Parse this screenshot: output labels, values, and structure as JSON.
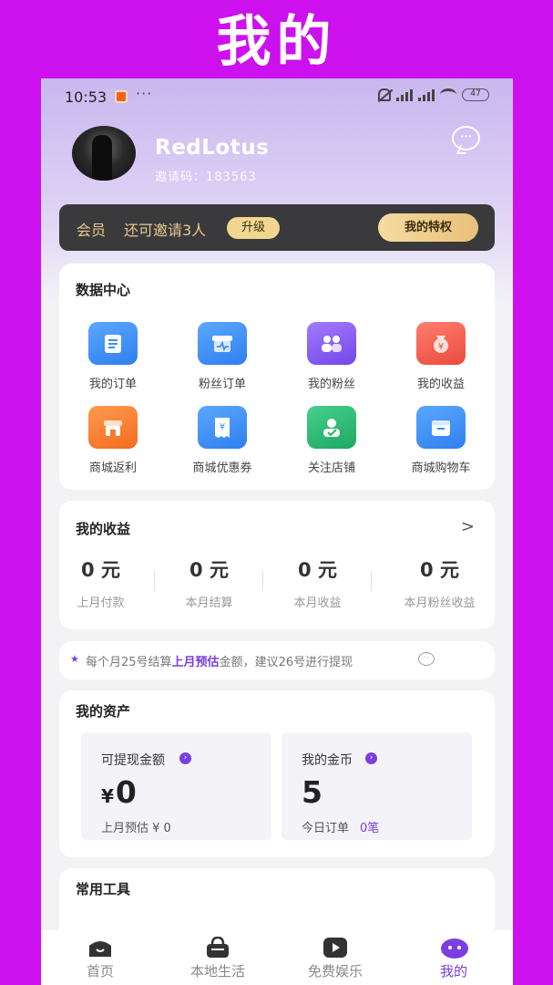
{
  "banner": {
    "title": "我的"
  },
  "status_bar": {
    "time": "10:53",
    "dots": "···",
    "battery": "47"
  },
  "profile": {
    "username": "RedLotus",
    "invite_code": "邀请码：183563"
  },
  "member_bar": {
    "label": "会员",
    "invite_text": "还可邀请3人",
    "upgrade": "升级",
    "privilege_button": "我的特权"
  },
  "data_center": {
    "title": "数据中心",
    "items": [
      {
        "label": "我的订单",
        "icon": "order-list-icon",
        "color": "#3d8ef5"
      },
      {
        "label": "粉丝订单",
        "icon": "fan-store-icon",
        "color": "#3d8ef5"
      },
      {
        "label": "我的粉丝",
        "icon": "fans-icon",
        "color": "#8b5cf6"
      },
      {
        "label": "我的收益",
        "icon": "money-bag-icon",
        "color": "#f05a4b"
      },
      {
        "label": "商城返利",
        "icon": "shop-rebate-icon",
        "color": "#f57a2e"
      },
      {
        "label": "商城优惠券",
        "icon": "coupon-icon",
        "color": "#3d8ef5"
      },
      {
        "label": "关注店铺",
        "icon": "follow-shop-icon",
        "color": "#27b56e"
      },
      {
        "label": "商城购物车",
        "icon": "cart-icon",
        "color": "#3d8ef5"
      }
    ]
  },
  "earnings": {
    "title": "我的收益",
    "arrow": ">",
    "columns": [
      {
        "value": "0 元",
        "label": "上月付款"
      },
      {
        "value": "0 元",
        "label": "本月结算"
      },
      {
        "value": "0 元",
        "label": "本月收益"
      },
      {
        "value": "0 元",
        "label": "本月粉丝收益"
      }
    ]
  },
  "notice": {
    "star": "★",
    "prefix": "每个月25号结算",
    "highlight": "上月预估",
    "suffix": "金额，建议26号进行提现"
  },
  "assets": {
    "title": "我的资产",
    "withdraw": {
      "title": "可提现金额",
      "currency": "¥",
      "value": "0",
      "sub": "上月预估 ¥ 0"
    },
    "coins": {
      "title": "我的金币",
      "value": "5",
      "sub": "今日订单",
      "sub_value": "0笔"
    }
  },
  "tools": {
    "title": "常用工具"
  },
  "tab_bar": {
    "tabs": [
      {
        "label": "首页",
        "icon": "home-face-icon"
      },
      {
        "label": "本地生活",
        "icon": "shopping-bag-icon"
      },
      {
        "label": "免费娱乐",
        "icon": "play-icon"
      },
      {
        "label": "我的",
        "icon": "profile-face-icon"
      }
    ],
    "active": "我的",
    "accent": "#7b3fe0"
  }
}
